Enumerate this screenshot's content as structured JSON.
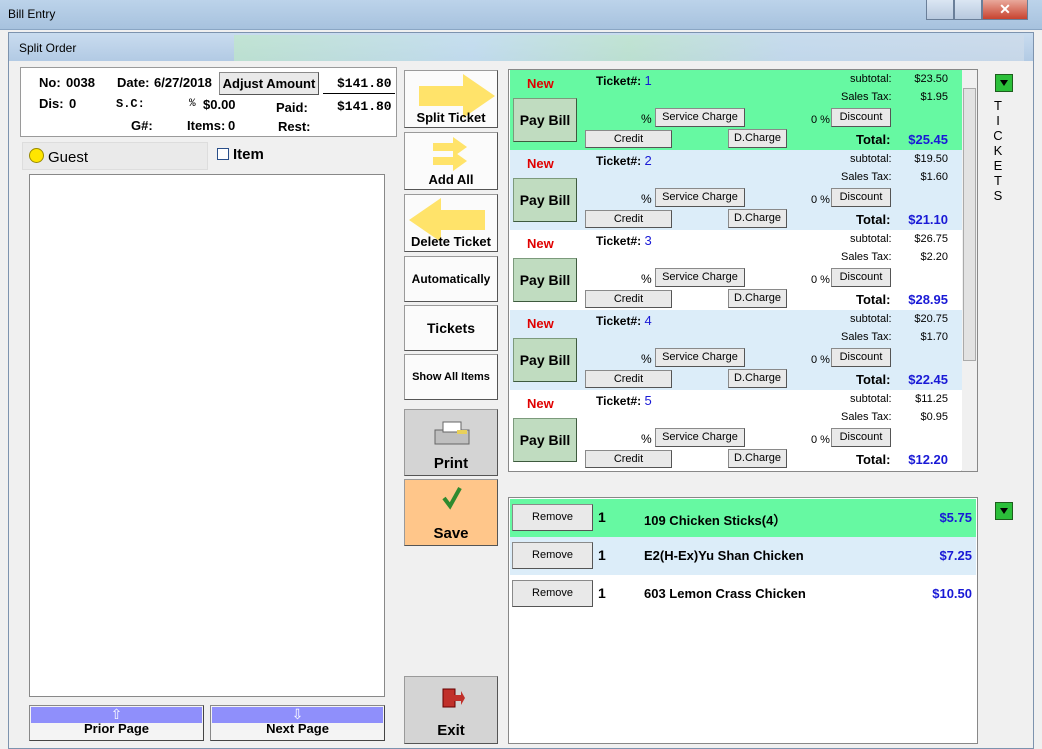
{
  "window": {
    "title": "Bill Entry",
    "inner_title": "Split Order",
    "close_glyph": "✕"
  },
  "header": {
    "no_label": "No:",
    "no_value": "0038",
    "date_label": "Date:",
    "date_value": "6/27/2018",
    "adjust_label": "Adjust Amount",
    "total_amount": "$141.80",
    "dis_label": "Dis:",
    "dis_value": "0",
    "sc_label": "S.C:",
    "sc_pct": "%",
    "sc_value": "$0.00",
    "paid_label": "Paid:",
    "paid_value": "$141.80",
    "g_label": "G#:",
    "items_label": "Items:",
    "items_value": "0",
    "rest_label": "Rest:"
  },
  "left_panel": {
    "guest_label": "Guest",
    "item_label": "Item"
  },
  "paging": {
    "prior": "Prior Page",
    "next": "Next Page"
  },
  "actions": {
    "split_ticket": "Split Ticket",
    "add_all": "Add All",
    "delete_ticket": "Delete Ticket",
    "automatically": "Automatically",
    "tickets": "Tickets",
    "show_all_items": "Show All Items",
    "print": "Print",
    "save": "Save",
    "exit": "Exit"
  },
  "ticket_labels": {
    "new": "New",
    "ticket": "Ticket#:",
    "pay_bill": "Pay Bill",
    "pct": "%",
    "service_charge": "Service Charge",
    "disc_pct": "0 %",
    "discount": "Discount",
    "credit": "Credit",
    "dcharge": "D.Charge",
    "subtotal": "subtotal:",
    "tax": "Sales Tax:",
    "total": "Total:"
  },
  "tickets": [
    {
      "number": "1",
      "subtotal": "$23.50",
      "tax": "$1.95",
      "total": "$25.45",
      "bg": "#66f9a2"
    },
    {
      "number": "2",
      "subtotal": "$19.50",
      "tax": "$1.60",
      "total": "$21.10",
      "bg": "#dcedf9"
    },
    {
      "number": "3",
      "subtotal": "$26.75",
      "tax": "$2.20",
      "total": "$28.95",
      "bg": "#ffffff"
    },
    {
      "number": "4",
      "subtotal": "$20.75",
      "tax": "$1.70",
      "total": "$22.45",
      "bg": "#dcedf9"
    },
    {
      "number": "5",
      "subtotal": "$11.25",
      "tax": "$0.95",
      "total": "$12.20",
      "bg": "#ffffff"
    }
  ],
  "side_label": "TICKETS",
  "items": {
    "remove_label": "Remove",
    "rows": [
      {
        "qty": "1",
        "name": "109 Chicken Sticks(4）",
        "price": "$5.75",
        "bg": "#66f9a2"
      },
      {
        "qty": "1",
        "name": "E2(H-Ex)Yu Shan Chicken",
        "price": "$7.25",
        "bg": "#dcedf9"
      },
      {
        "qty": "1",
        "name": "603 Lemon Crass Chicken",
        "price": "$10.50",
        "bg": "#ffffff"
      }
    ]
  }
}
